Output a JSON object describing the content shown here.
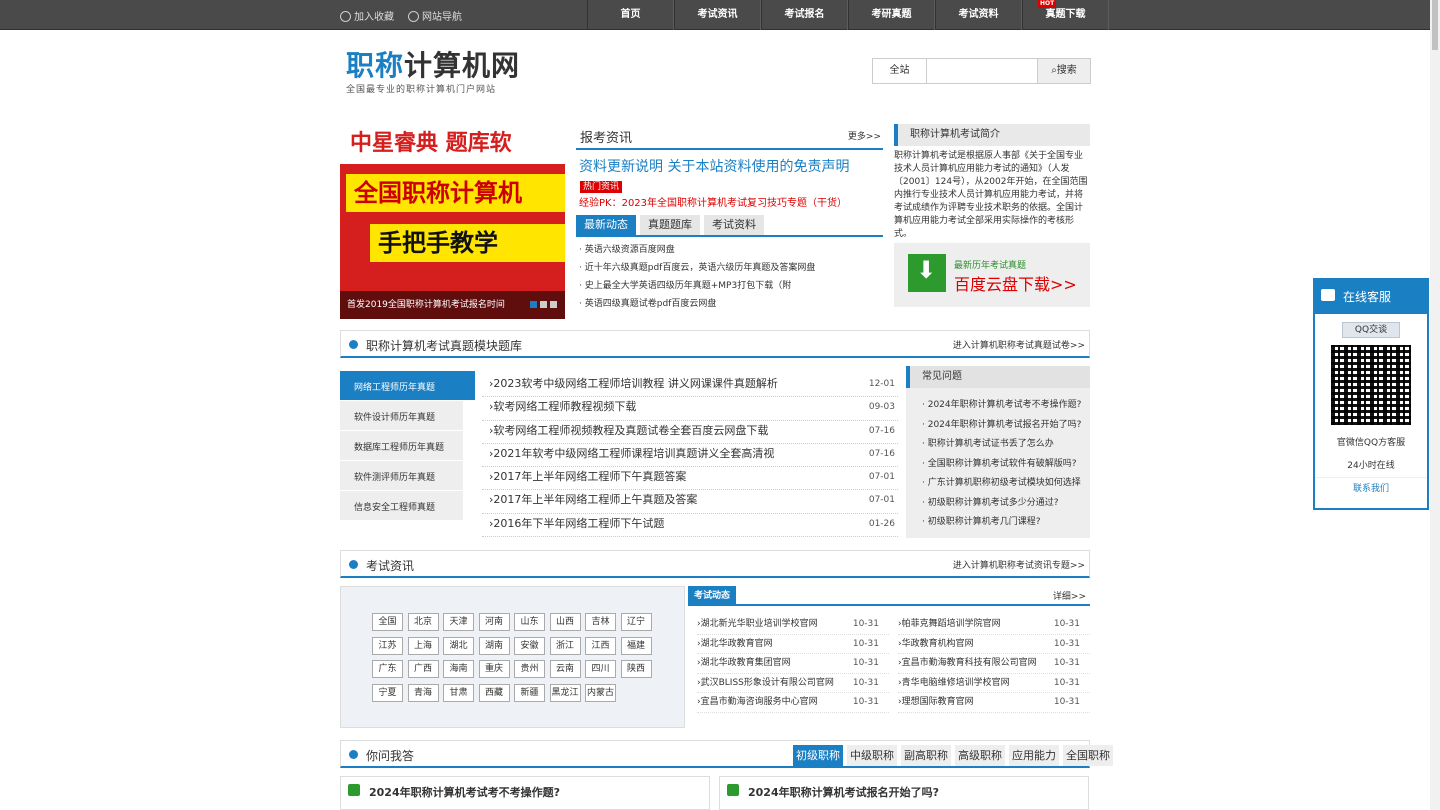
{
  "top": {
    "bookmark": "加入收藏",
    "sitenav": "网站导航",
    "nav": [
      "首页",
      "考试资讯",
      "考试报名",
      "考研真题",
      "考试资料",
      "真题下载"
    ],
    "hot": "HOT"
  },
  "logo": {
    "part1": "职称",
    "part2": "计算机网",
    "sub": "全国最专业的职称计算机门户网站"
  },
  "search": {
    "scope": "全站",
    "button": "搜索",
    "value": ""
  },
  "banner": {
    "t1": "中星睿典 题库软",
    "t2": "全国职称计算机",
    "t3": "手把手教学",
    "caption": "首发2019全国职称计算机考试报名时间"
  },
  "news": {
    "title": "报考资讯",
    "more": "更多>>",
    "headline": "资料更新说明 关于本站资料使用的免责声明",
    "hot_tag": "热门资讯",
    "hot_line": "经验PK：2023年全国职称计算机考试复习技巧专题（干货）",
    "tabs": [
      "最新动态",
      "真题题库",
      "考试资料"
    ],
    "items": [
      "英语六级资源百度网盘",
      "近十年六级真题pdf百度云，英语六级历年真题及答案网盘",
      "史上最全大学英语四级历年真题+MP3打包下载（附",
      "英语四级真题试卷pdf百度云网盘"
    ]
  },
  "intro": {
    "title": "职称计算机考试简介",
    "text": "职称计算机考试是根据原人事部《关于全国专业技术人员计算机应用能力考试的通知》（人发〔2001〕124号），从2002年开始，在全国范围内推行专业技术人员计算机应用能力考试，并将考试成绩作为评聘专业技术职务的依据。全国计算机应用能力考试全部采用实际操作的考核形式。"
  },
  "download": {
    "l1": "最新历年考试真题",
    "l2": "百度云盘下载>>"
  },
  "sec1": {
    "title": "职称计算机考试真题模块题库",
    "right": "进入计算机职称考试真题试卷>>"
  },
  "cats": [
    "网络工程师历年真题",
    "软件设计师历年真题",
    "数据库工程师历年真题",
    "软件测评师历年真题",
    "信息安全工程师真题"
  ],
  "qlist": [
    {
      "t": "2023软考中级网络工程师培训教程 讲义网课课件真题解析",
      "d": "12-01"
    },
    {
      "t": "软考网络工程师教程视频下载",
      "d": "09-03"
    },
    {
      "t": "软考网络工程师视频教程及真题试卷全套百度云网盘下载",
      "d": "07-16"
    },
    {
      "t": "2021年软考中级网络工程师课程培训真题讲义全套高清视",
      "d": "07-16"
    },
    {
      "t": "2017年上半年网络工程师下午真题答案",
      "d": "07-01"
    },
    {
      "t": "2017年上半年网络工程师上午真题及答案",
      "d": "07-01"
    },
    {
      "t": "2016年下半年网络工程师下午试题",
      "d": "01-26"
    }
  ],
  "faq": {
    "title": "常见问题",
    "items": [
      "2024年职称计算机考试考不考操作题?",
      "2024年职称计算机考试报名开始了吗?",
      "职称计算机考试证书丢了怎么办",
      "全国职称计算机考试软件有破解版吗?",
      "广东计算机职称初级考试模块如何选择",
      "初级职称计算机考试多少分通过?",
      "初级职称计算机考几门课程?"
    ]
  },
  "sec2": {
    "title": "考试资讯",
    "right": "进入计算机职称考试资讯专题>>"
  },
  "cities": [
    "全国",
    "北京",
    "天津",
    "河南",
    "山东",
    "山西",
    "吉林",
    "辽宁",
    "江苏",
    "上海",
    "湖北",
    "湖南",
    "安徽",
    "浙江",
    "江西",
    "福建",
    "广东",
    "广西",
    "海南",
    "重庆",
    "贵州",
    "云南",
    "四川",
    "陕西",
    "宁夏",
    "青海",
    "甘肃",
    "西藏",
    "新疆",
    "黑龙江",
    "内蒙古"
  ],
  "dyn": {
    "title": "考试动态",
    "more": "详细>>",
    "left": [
      {
        "t": "湖北新光华职业培训学校官网",
        "d": "10-31"
      },
      {
        "t": "湖北华政教育官网",
        "d": "10-31"
      },
      {
        "t": "湖北华政教育集团官网",
        "d": "10-31"
      },
      {
        "t": "武汉BLISS形象设计有限公司官网",
        "d": "10-31"
      },
      {
        "t": "宜昌市勤海咨询服务中心官网",
        "d": "10-31"
      }
    ],
    "right": [
      {
        "t": "帕菲克舞蹈培训学院官网",
        "d": "10-31"
      },
      {
        "t": "华政教育机构官网",
        "d": "10-31"
      },
      {
        "t": "宜昌市勤海教育科技有限公司官网",
        "d": "10-31"
      },
      {
        "t": "青华电脑维修培训学校官网",
        "d": "10-31"
      },
      {
        "t": "理想国际教育官网",
        "d": "10-31"
      }
    ]
  },
  "ask": {
    "title": "你问我答",
    "tabs": [
      "初级职称",
      "中级职称",
      "副高职称",
      "高级职称",
      "应用能力",
      "全国职称"
    ],
    "q1": "2024年职称计算机考试考不考操作题?",
    "q2": "2024年职称计算机考试报名开始了吗?"
  },
  "kf": {
    "title": "在线客服",
    "qq": "QQ交谈",
    "l1": "官微信QQ方客服",
    "l2": "24小时在线",
    "l3": "联系我们"
  }
}
